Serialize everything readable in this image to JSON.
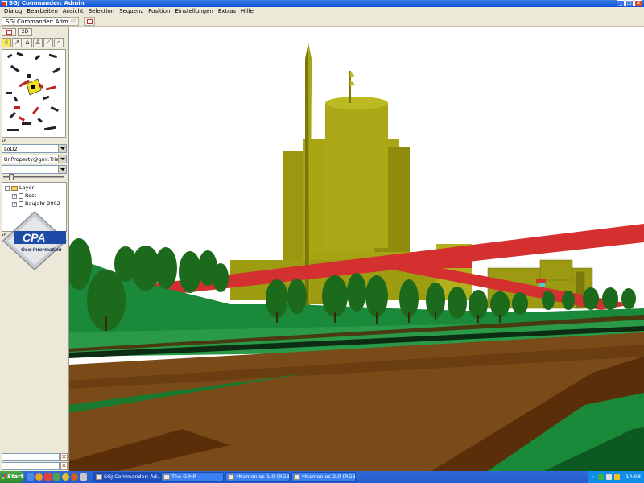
{
  "window": {
    "title": "SGJ Commander: Admin",
    "controls": {
      "minimize": "_",
      "maximize": "□",
      "close": "x"
    }
  },
  "menu": [
    "Dialog",
    "Bearbeiten",
    "Ansicht",
    "Selektion",
    "Sequenz",
    "Position",
    "Einstellungen",
    "Extras",
    "Hilfe"
  ],
  "toolbar": {
    "tab_label": "SGJ Commander: Admin",
    "back_glyph": "⇦"
  },
  "left_panel": {
    "tabs": {
      "view_2d": "2D"
    },
    "tools": [
      "tool-1",
      "tool-2",
      "tool-3",
      "tool-4",
      "tool-5",
      "tool-6"
    ],
    "combo_1": "LoD2",
    "combo_2": "tinProperty@gml:Tria...",
    "combo_3": "",
    "slider_value": 0.1,
    "layers": {
      "root": "Layer",
      "items": [
        {
          "label": "Rost",
          "checked": true
        },
        {
          "label": "Baujahr 2002",
          "checked": true
        }
      ]
    },
    "logo": {
      "name": "CPA",
      "subtitle": "Geo-Information"
    }
  },
  "taskbar": {
    "start": "Start",
    "tasks": [
      {
        "label": "SGJ Commander: Ad...",
        "active": true
      },
      {
        "label": "The GIMP",
        "active": false
      },
      {
        "label": "*Namenlos-1.0 (RGB, 1 ...",
        "active": false
      },
      {
        "label": "*Namenlos-2.0 (RGB, 1 ...",
        "active": false
      }
    ],
    "tray_chevron": "«",
    "clock": "14:08"
  },
  "colors": {
    "titlebar": "#0a50d8",
    "grass": "#1a8a3a",
    "dirt": "#7a4a18",
    "building": "#9c9a12",
    "red_band": "#d43030",
    "tree": "#1c6a1c"
  }
}
